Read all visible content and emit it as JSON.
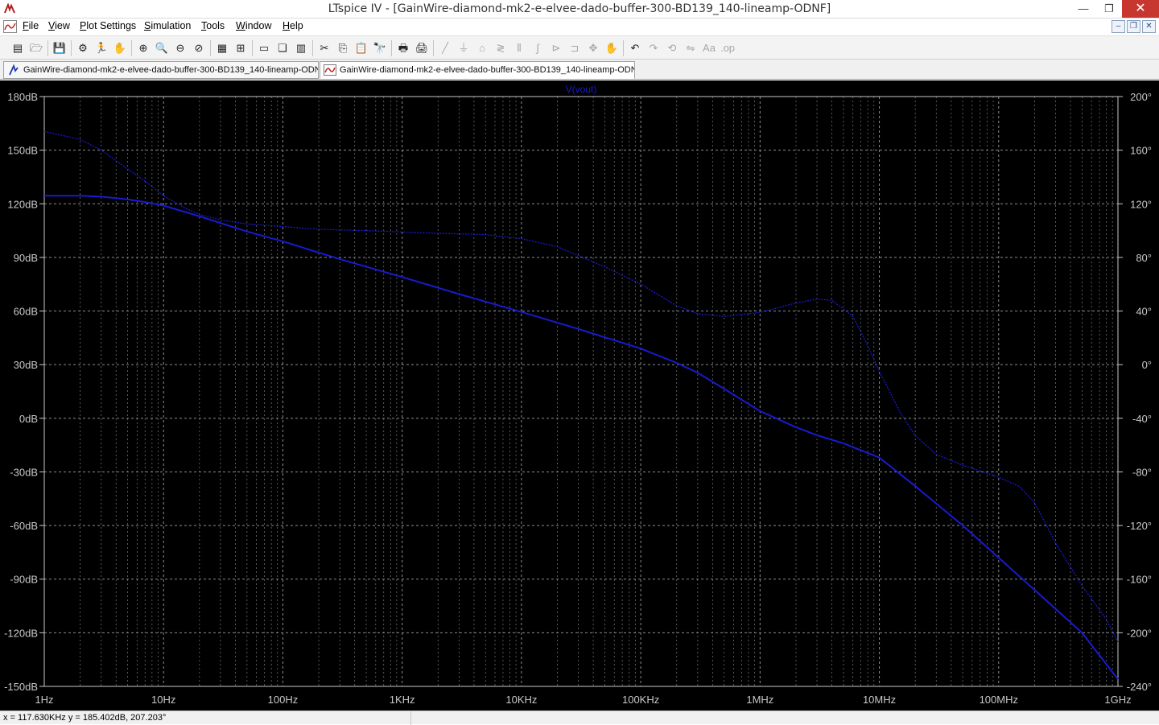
{
  "window": {
    "title": "LTspice IV - [GainWire-diamond-mk2-e-elvee-dado-buffer-300-BD139_140-lineamp-ODNF]",
    "minimize": "—",
    "maximize": "❐",
    "close": "✕"
  },
  "menu": [
    "File",
    "View",
    "Plot Settings",
    "Simulation",
    "Tools",
    "Window",
    "Help"
  ],
  "mdi": [
    "–",
    "❐",
    "✕"
  ],
  "tabs": [
    {
      "label": "GainWire-diamond-mk2-e-elvee-dado-buffer-300-BD139_140-lineamp-ODNF",
      "icon": "schematic-icon",
      "active": false
    },
    {
      "label": "GainWire-diamond-mk2-e-elvee-dado-buffer-300-BD139_140-lineamp-ODNF",
      "icon": "waveform-icon",
      "active": true
    }
  ],
  "toolbar": [
    {
      "icon": "open-schematic-icon",
      "glyph": "▤",
      "dim": false
    },
    {
      "icon": "open-folder-icon",
      "glyph": "🗁",
      "dim": false
    },
    {
      "icon": "save-icon",
      "glyph": "💾",
      "dim": false
    },
    {
      "icon": "settings-icon",
      "glyph": "⚙",
      "dim": false
    },
    {
      "icon": "run-icon",
      "glyph": "🏃",
      "dim": false
    },
    {
      "icon": "halt-icon",
      "glyph": "✋",
      "dim": false
    },
    {
      "icon": "zoom-in-icon",
      "glyph": "⊕",
      "dim": false
    },
    {
      "icon": "zoom-area-icon",
      "glyph": "🔍",
      "dim": false
    },
    {
      "icon": "zoom-out-icon",
      "glyph": "⊖",
      "dim": false
    },
    {
      "icon": "zoom-cancel-icon",
      "glyph": "⊘",
      "dim": false
    },
    {
      "icon": "autorange-icon",
      "glyph": "▦",
      "dim": false
    },
    {
      "icon": "fit-icon",
      "glyph": "⊞",
      "dim": false
    },
    {
      "icon": "tile-horizontal-icon",
      "glyph": "▭",
      "dim": false
    },
    {
      "icon": "cascade-icon",
      "glyph": "❏",
      "dim": false
    },
    {
      "icon": "tile-vertical-icon",
      "glyph": "▥",
      "dim": false
    },
    {
      "icon": "cut-icon",
      "glyph": "✂",
      "dim": false
    },
    {
      "icon": "copy-icon",
      "glyph": "⎘",
      "dim": false
    },
    {
      "icon": "paste-icon",
      "glyph": "📋",
      "dim": false
    },
    {
      "icon": "find-icon",
      "glyph": "🔭",
      "dim": false
    },
    {
      "icon": "print-icon",
      "glyph": "🖶",
      "dim": false
    },
    {
      "icon": "print-preview-icon",
      "glyph": "🖨",
      "dim": false
    },
    {
      "icon": "wire-icon",
      "glyph": "╱",
      "dim": true
    },
    {
      "icon": "ground-icon",
      "glyph": "⏚",
      "dim": true
    },
    {
      "icon": "label-icon",
      "glyph": "⌂",
      "dim": true
    },
    {
      "icon": "resistor-icon",
      "glyph": "≷",
      "dim": true
    },
    {
      "icon": "capacitor-icon",
      "glyph": "⫴",
      "dim": true
    },
    {
      "icon": "inductor-icon",
      "glyph": "∫",
      "dim": true
    },
    {
      "icon": "diode-icon",
      "glyph": "⊳",
      "dim": true
    },
    {
      "icon": "component-icon",
      "glyph": "⊐",
      "dim": true
    },
    {
      "icon": "move-icon",
      "glyph": "✥",
      "dim": true
    },
    {
      "icon": "drag-icon",
      "glyph": "✋",
      "dim": true
    },
    {
      "icon": "undo-icon",
      "glyph": "↶",
      "dim": false
    },
    {
      "icon": "redo-icon",
      "glyph": "↷",
      "dim": true
    },
    {
      "icon": "rotate-icon",
      "glyph": "⟲",
      "dim": true
    },
    {
      "icon": "mirror-icon",
      "glyph": "⇋",
      "dim": true
    },
    {
      "icon": "text-icon",
      "glyph": "Aa",
      "dim": true
    },
    {
      "icon": "spice-directive-icon",
      "glyph": ".op",
      "dim": true
    }
  ],
  "chart_data": {
    "type": "line",
    "title": "V(vout)",
    "x_scale": "log",
    "xlim": [
      1,
      1000000000
    ],
    "x_ticks": [
      {
        "value": 1,
        "label": "1Hz"
      },
      {
        "value": 10,
        "label": "10Hz"
      },
      {
        "value": 100,
        "label": "100Hz"
      },
      {
        "value": 1000,
        "label": "1KHz"
      },
      {
        "value": 10000,
        "label": "10KHz"
      },
      {
        "value": 100000,
        "label": "100KHz"
      },
      {
        "value": 1000000,
        "label": "1MHz"
      },
      {
        "value": 10000000,
        "label": "10MHz"
      },
      {
        "value": 100000000,
        "label": "100MHz"
      },
      {
        "value": 1000000000,
        "label": "1GHz"
      }
    ],
    "ylim_left": [
      -150,
      180
    ],
    "y_ticks_left": [
      {
        "value": 180,
        "label": "180dB"
      },
      {
        "value": 150,
        "label": "150dB"
      },
      {
        "value": 120,
        "label": "120dB"
      },
      {
        "value": 90,
        "label": "90dB"
      },
      {
        "value": 60,
        "label": "60dB"
      },
      {
        "value": 30,
        "label": "30dB"
      },
      {
        "value": 0,
        "label": "0dB"
      },
      {
        "value": -30,
        "label": "-30dB"
      },
      {
        "value": -60,
        "label": "-60dB"
      },
      {
        "value": -90,
        "label": "-90dB"
      },
      {
        "value": -120,
        "label": "-120dB"
      },
      {
        "value": -150,
        "label": "-150dB"
      }
    ],
    "ylim_right": [
      -240,
      200
    ],
    "y_ticks_right": [
      {
        "value": 200,
        "label": "200°"
      },
      {
        "value": 160,
        "label": "160°"
      },
      {
        "value": 120,
        "label": "120°"
      },
      {
        "value": 80,
        "label": "80°"
      },
      {
        "value": 40,
        "label": "40°"
      },
      {
        "value": 0,
        "label": "0°"
      },
      {
        "value": -40,
        "label": "-40°"
      },
      {
        "value": -80,
        "label": "-80°"
      },
      {
        "value": -120,
        "label": "-120°"
      },
      {
        "value": -160,
        "label": "-160°"
      },
      {
        "value": -200,
        "label": "-200°"
      },
      {
        "value": -240,
        "label": "-240°"
      }
    ],
    "grid": true,
    "colors": {
      "background": "#000000",
      "grid": "#8c8c8c",
      "axis_text": "#c8c8c8",
      "trace": "#1a1ad0",
      "trace_title": "#1a1ad0"
    },
    "series": [
      {
        "axis": "left",
        "style": "solid",
        "x": [
          1,
          2,
          3,
          5,
          7,
          10,
          20,
          50,
          100,
          300,
          1000,
          3000,
          10000,
          30000,
          100000,
          200000,
          300000,
          500000,
          1000000,
          2000000,
          3000000,
          5000000,
          10000000,
          20000000,
          50000000,
          100000000,
          200000000,
          500000000,
          1000000000
        ],
        "y": [
          124.5,
          124.5,
          124,
          122.5,
          121,
          119,
          113,
          104.5,
          99,
          89,
          79,
          69.5,
          59.5,
          50,
          39,
          31,
          25.5,
          16.5,
          4,
          -5,
          -9.5,
          -14,
          -22,
          -38,
          -60,
          -78,
          -96,
          -120,
          -146
        ]
      },
      {
        "axis": "right",
        "style": "dashed",
        "x": [
          1,
          2,
          3,
          5,
          7,
          10,
          15,
          20,
          30,
          50,
          100,
          200,
          500,
          1000,
          2000,
          5000,
          10000,
          20000,
          50000,
          100000,
          200000,
          300000,
          500000,
          1000000,
          2000000,
          3000000,
          4000000,
          6000000,
          8000000,
          10000000,
          15000000,
          20000000,
          30000000,
          50000000,
          80000000,
          100000000,
          150000000,
          200000000,
          300000000,
          500000000,
          800000000,
          1000000000
        ],
        "y": [
          174,
          168,
          160,
          146,
          137,
          126,
          117,
          112,
          108,
          105,
          103,
          101,
          100,
          99,
          98,
          97,
          94,
          88,
          73,
          60,
          44,
          38,
          36,
          39,
          46,
          49,
          48,
          36,
          14,
          -5,
          -36,
          -53,
          -67,
          -75,
          -81,
          -84,
          -91,
          -103,
          -133,
          -165,
          -190,
          -207
        ]
      }
    ]
  },
  "status": {
    "readout": "x = 117.630KHz    y = 185.402dB, 207.203°"
  }
}
